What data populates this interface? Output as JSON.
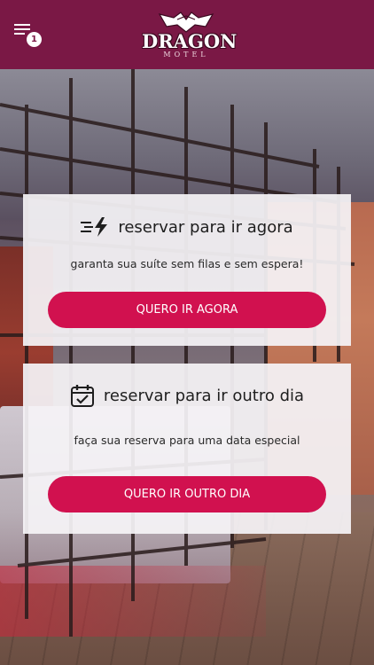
{
  "header": {
    "menu_badge_count": "1",
    "logo_text": "DRAGON",
    "logo_subtext": "MOTEL",
    "background_color": "#7a1845"
  },
  "cards": [
    {
      "icon": "fast-lightning-icon",
      "title": "reservar para ir agora",
      "subtitle": "garanta sua suíte sem filas e sem espera!",
      "button_label": "QUERO IR AGORA"
    },
    {
      "icon": "calendar-check-icon",
      "title": "reservar para ir outro dia",
      "subtitle": "faça sua reserva para uma data especial",
      "button_label": "QUERO IR OUTRO DIA"
    }
  ],
  "colors": {
    "primary": "#7a1845",
    "accent": "#d1114f",
    "card_background": "#f5f3f6"
  }
}
